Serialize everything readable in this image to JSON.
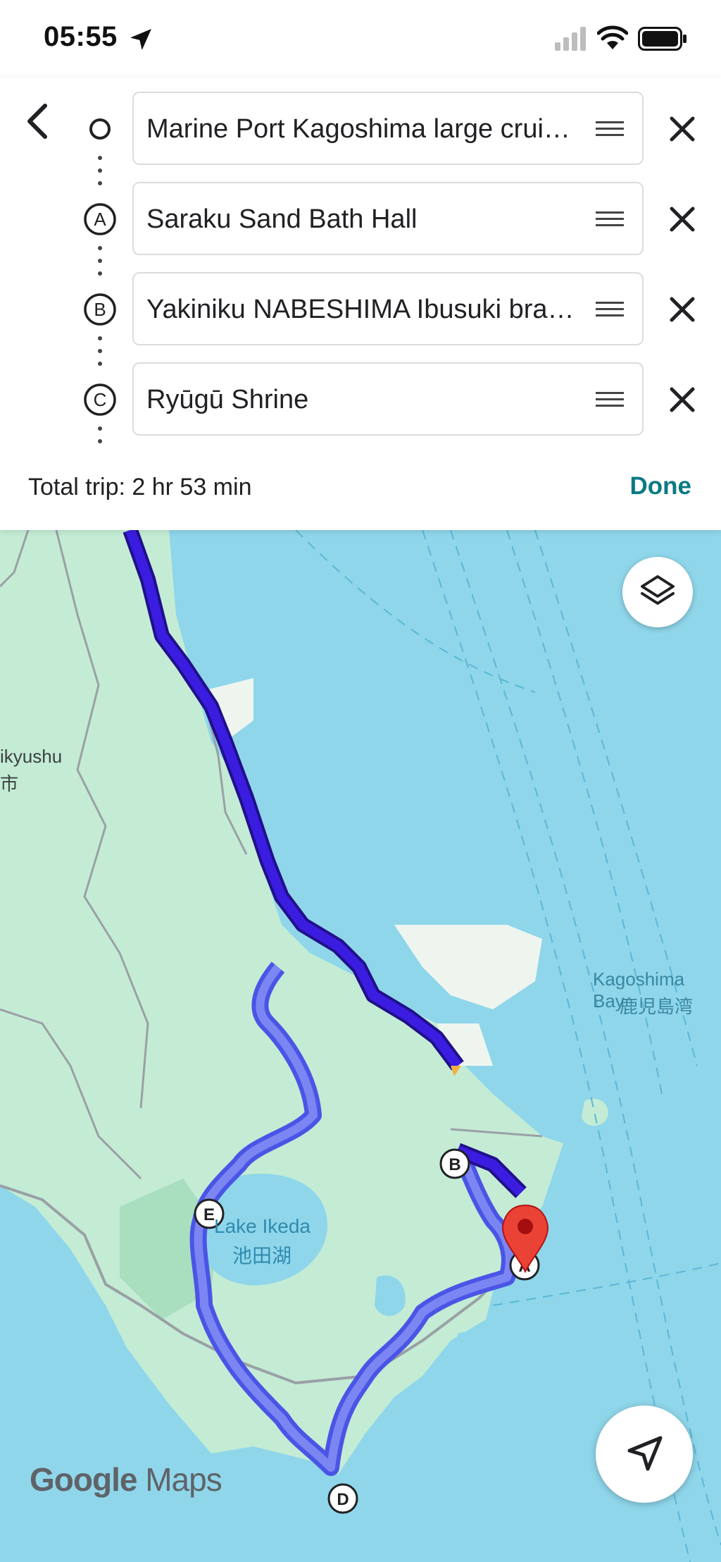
{
  "status_bar": {
    "time": "05:55"
  },
  "route_panel": {
    "stops": [
      {
        "marker": "",
        "label": "Marine Port Kagoshima large crui…"
      },
      {
        "marker": "A",
        "label": "Saraku Sand Bath Hall"
      },
      {
        "marker": "B",
        "label": "Yakiniku NABESHIMA Ibusuki bra…"
      },
      {
        "marker": "C",
        "label": "Ryūgū Shrine"
      }
    ],
    "total_trip": "Total trip: 2 hr 53 min",
    "done_label": "Done"
  },
  "map": {
    "labels": {
      "city_en": "ikyushu",
      "city_jp": "市",
      "bay_en": "Kagoshima Bay",
      "bay_jp": "鹿児島湾",
      "lake_en": "Lake Ikeda",
      "lake_jp": "池田湖"
    },
    "waypoints": [
      "A",
      "B",
      "D",
      "E"
    ],
    "logo": {
      "google": "Google",
      "maps": "Maps"
    }
  },
  "colors": {
    "route_primary": "#3a1de0",
    "route_alt": "#6b74f0",
    "water": "#8fd6ea",
    "land": "#c4ecd5",
    "accent_done": "#0b7a84",
    "pin": "#ea4335"
  }
}
